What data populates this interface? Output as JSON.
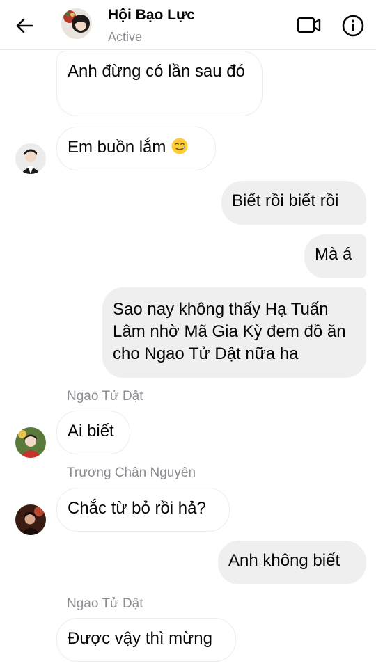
{
  "header": {
    "title": "Hội Bạo Lực",
    "status": "Active"
  },
  "messages": [
    {
      "side": "in",
      "text": "Anh đừng có lần sau đó"
    },
    {
      "side": "in",
      "text": "Em buồn lắm",
      "emoji": "smiling-face-with-tear"
    },
    {
      "side": "out",
      "text": "Biết rồi biết rồi"
    },
    {
      "side": "out",
      "text": "Mà á"
    },
    {
      "side": "out",
      "text": "Sao nay không thấy Hạ Tuấn Lâm nhờ Mã Gia Kỳ đem đồ ăn cho Ngao Tử Dật nữa ha"
    },
    {
      "side": "in",
      "sender": "Ngao Tử Dật",
      "text": "Ai biết"
    },
    {
      "side": "in",
      "sender": "Trương Chân Nguyên",
      "text": "Chắc từ bỏ rồi hả?"
    },
    {
      "side": "out",
      "text": "Anh không biết"
    },
    {
      "side": "in",
      "sender": "Ngao Tử Dật",
      "text": "Được vậy thì mừng"
    }
  ],
  "icons": {
    "back": "arrow-left-icon",
    "video": "video-camera-icon",
    "info": "info-icon"
  },
  "colors": {
    "outgoing_bubble": "#efefef",
    "incoming_border": "#ececec",
    "secondary_text": "#8a8d91"
  }
}
